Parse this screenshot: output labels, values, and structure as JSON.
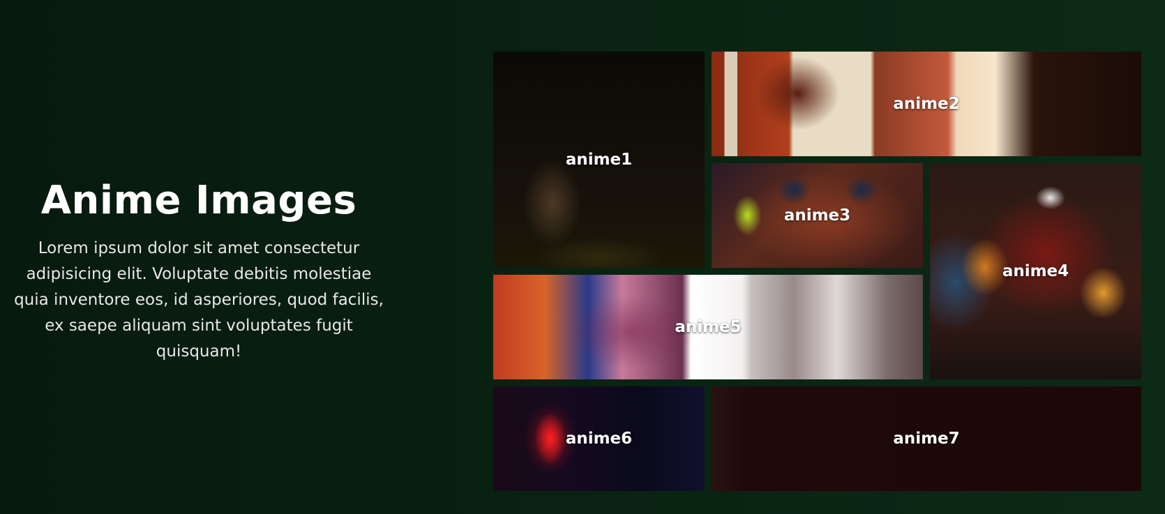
{
  "intro": {
    "title": "Anime Images",
    "description": "Lorem ipsum dolor sit amet consectetur adipisicing elit. Voluptate debitis molestiae quia inventore eos, id asperiores, quod facilis, ex saepe aliquam sint voluptates fugit quisquam!"
  },
  "gallery": {
    "tiles": [
      {
        "label": "anime1"
      },
      {
        "label": "anime2"
      },
      {
        "label": "anime3"
      },
      {
        "label": "anime4"
      },
      {
        "label": "anime5"
      },
      {
        "label": "anime6"
      },
      {
        "label": "anime7"
      }
    ]
  },
  "colors": {
    "background": "#0a2412",
    "text": "#ffffff"
  }
}
